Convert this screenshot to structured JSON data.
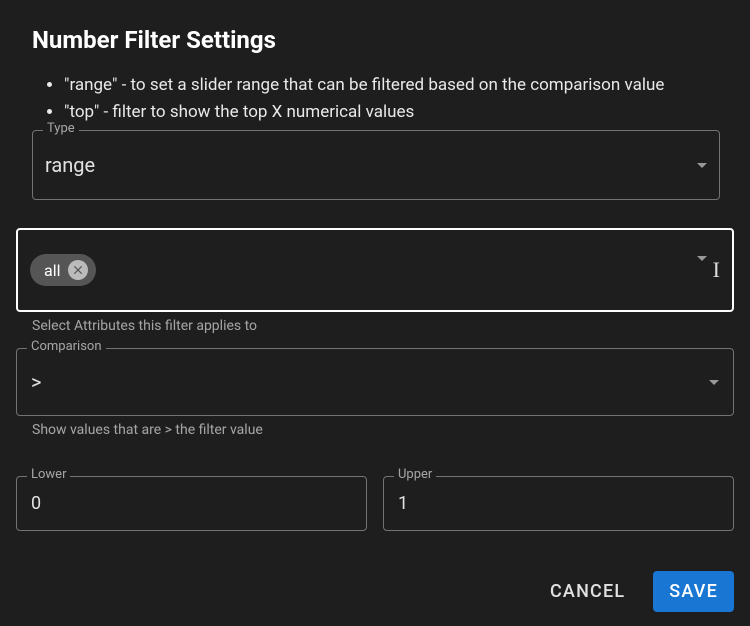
{
  "title": "Number Filter Settings",
  "descriptions": [
    "\"range\" - to set a slider range that can be filtered based on the comparison value",
    "\"top\" - filter to show the top X numerical values"
  ],
  "type_field": {
    "label": "Type",
    "value": "range"
  },
  "attributes_field": {
    "chips": [
      {
        "label": "all"
      }
    ],
    "helper": "Select Attributes this filter applies to"
  },
  "comparison_field": {
    "label": "Comparison",
    "value": ">",
    "helper": "Show values that are > the filter value"
  },
  "lower_field": {
    "label": "Lower",
    "value": "0"
  },
  "upper_field": {
    "label": "Upper",
    "value": "1"
  },
  "buttons": {
    "cancel": "Cancel",
    "save": "Save"
  }
}
